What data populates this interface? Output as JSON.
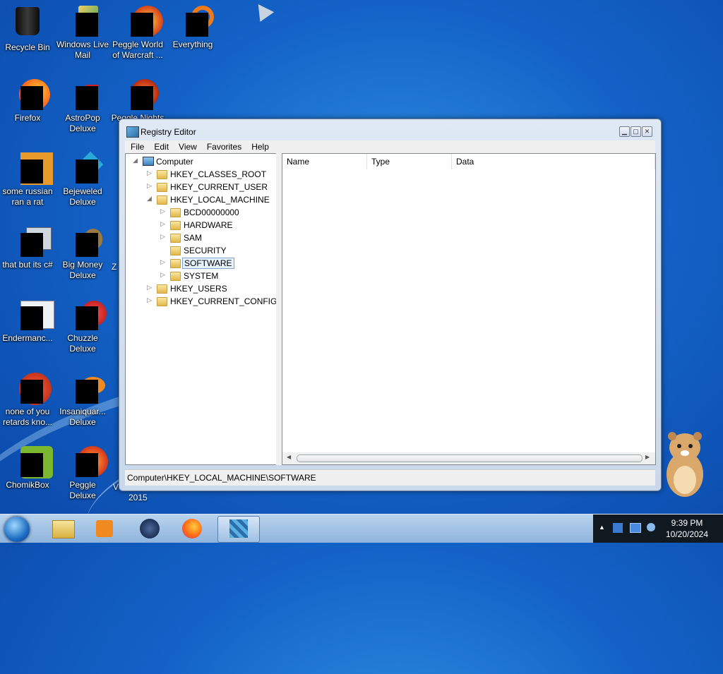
{
  "desktop": {
    "icons": [
      {
        "label": "Recycle Bin"
      },
      {
        "label": "Windows Live Mail"
      },
      {
        "label": "Peggle World of Warcraft ..."
      },
      {
        "label": "Everything"
      },
      {
        "label": "Firefox"
      },
      {
        "label": "AstroPop Deluxe"
      },
      {
        "label": "Peggle Nights"
      },
      {
        "label": "some russian ran a rat"
      },
      {
        "label": "Bejeweled Deluxe"
      },
      {
        "label": "that but its c#"
      },
      {
        "label": "Big Money Deluxe"
      },
      {
        "label": "Endermanc..."
      },
      {
        "label": "Chuzzle Deluxe"
      },
      {
        "label": "none of you retards kno..."
      },
      {
        "label": "Insaniquar... Deluxe"
      },
      {
        "label": "ChomikBox"
      },
      {
        "label": "Peggle Deluxe"
      }
    ],
    "partial_labels": {
      "z_label": "Z",
      "v_label": "V",
      "year_label": "2015"
    }
  },
  "window": {
    "title": "Registry Editor",
    "menu": [
      "File",
      "Edit",
      "View",
      "Favorites",
      "Help"
    ],
    "tree": {
      "root": "Computer",
      "hives": [
        "HKEY_CLASSES_ROOT",
        "HKEY_CURRENT_USER",
        "HKEY_LOCAL_MACHINE",
        "HKEY_USERS",
        "HKEY_CURRENT_CONFIG"
      ],
      "hklm_children": [
        "BCD00000000",
        "HARDWARE",
        "SAM",
        "SECURITY",
        "SOFTWARE",
        "SYSTEM"
      ],
      "selected": "SOFTWARE"
    },
    "columns": [
      "Name",
      "Type",
      "Data"
    ],
    "status": "Computer\\HKEY_LOCAL_MACHINE\\SOFTWARE"
  },
  "taskbar": {
    "time": "9:39 PM",
    "date": "10/20/2024"
  }
}
